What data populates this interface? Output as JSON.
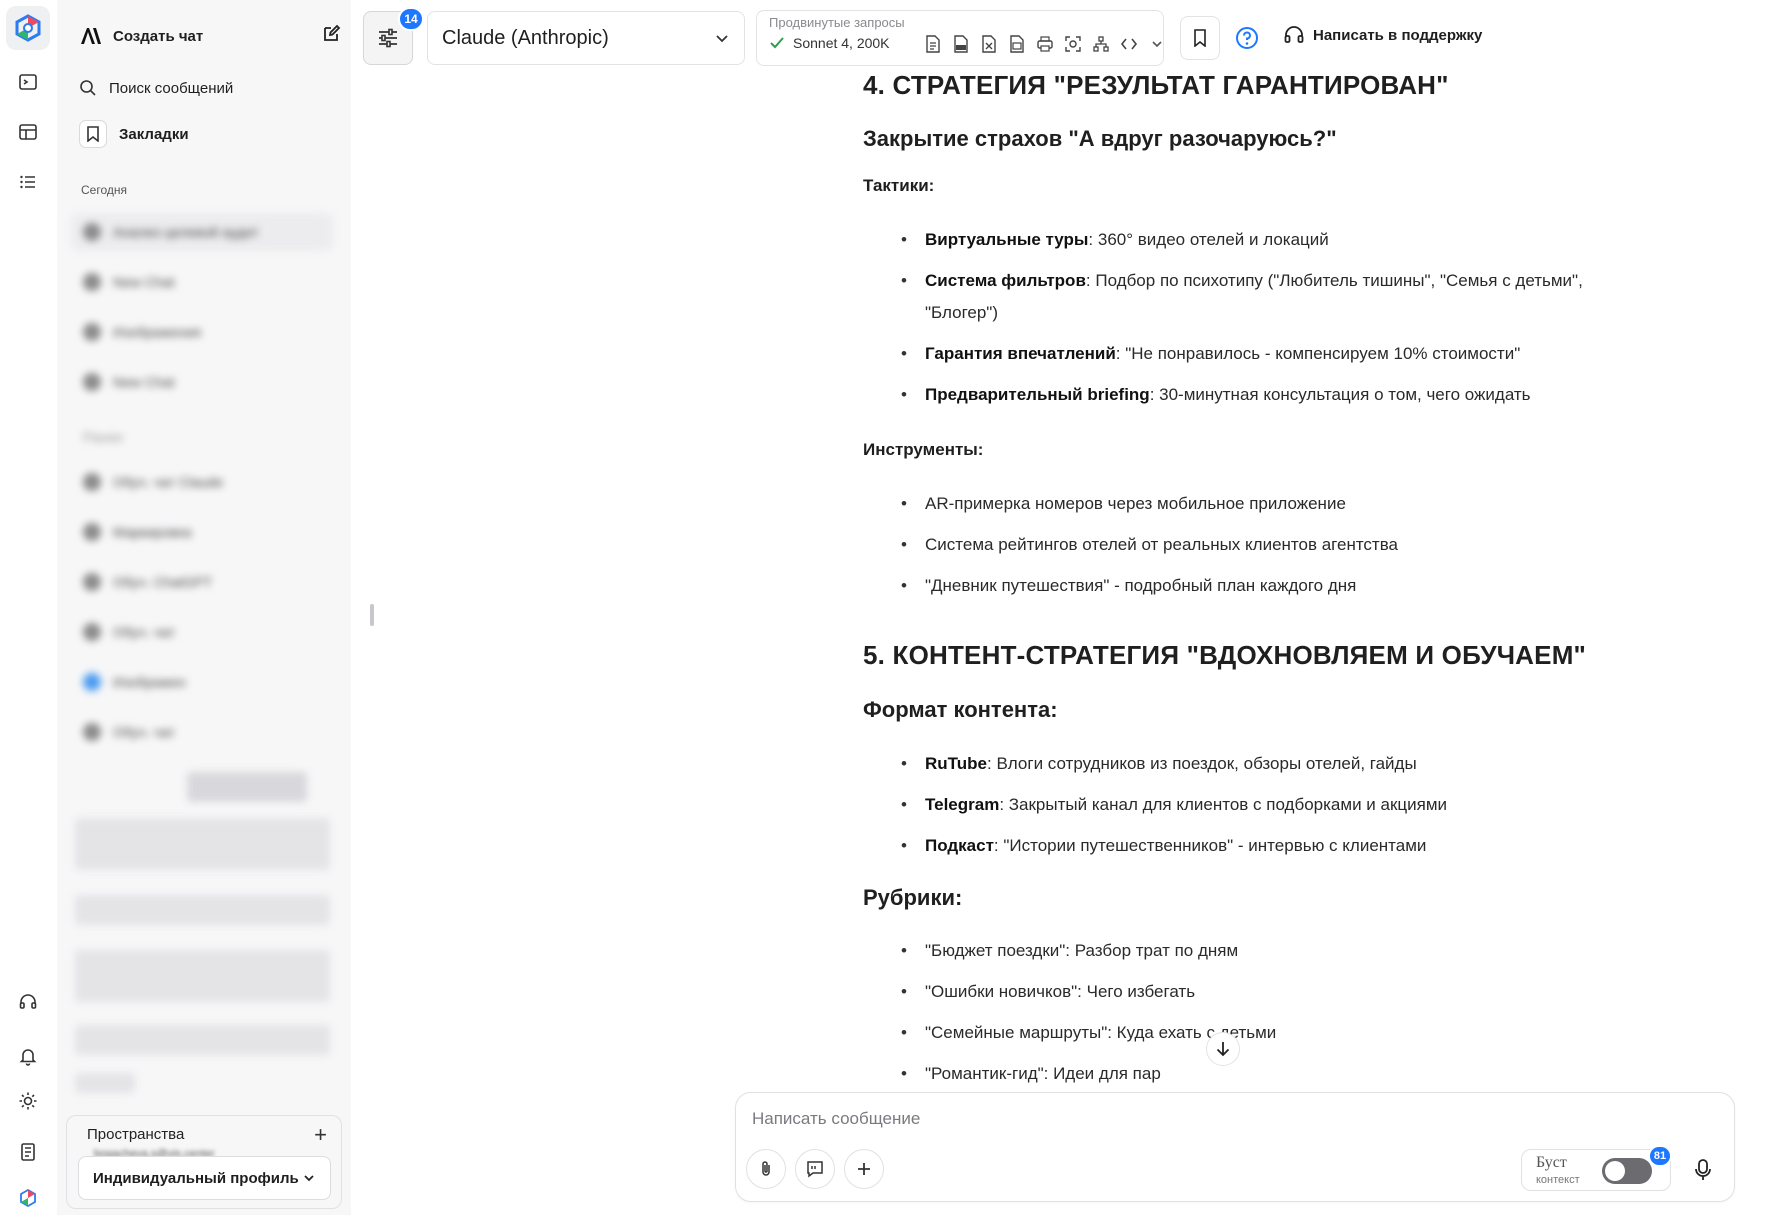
{
  "sidebar": {
    "new_chat": "Создать чат",
    "search": "Поиск сообщений",
    "bookmarks": "Закладки",
    "section_today": "Сегодня",
    "spaces_title": "Пространства",
    "profile": "Индивидуальный профиль"
  },
  "toolbar": {
    "settings_badge": "14",
    "model": "Claude (Anthropic)",
    "advanced_title": "Продвинутые запросы",
    "advanced_model": "Sonnet 4, 200K",
    "support": "Написать в поддержку"
  },
  "content": {
    "h4": "4. СТРАТЕГИЯ \"РЕЗУЛЬТАТ ГАРАНТИРОВАН\"",
    "h4_sub": "Закрытие страхов \"А вдруг разочаруюсь?\"",
    "tactics_label": "Тактики:",
    "tactics": [
      {
        "bold": "Виртуальные туры",
        "text": ": 360° видео отелей и локаций"
      },
      {
        "bold": "Система фильтров",
        "text": ": Подбор по психотипу (\"Любитель тишины\", \"Семья с детьми\", \"Блогер\")"
      },
      {
        "bold": "Гарантия впечатлений",
        "text": ": \"Не понравилось - компенсируем 10% стоимости\""
      },
      {
        "bold": "Предварительный briefing",
        "text": ": 30-минутная консультация о том, чего ожидать"
      }
    ],
    "tools_label": "Инструменты:",
    "tools": [
      "AR-примерка номеров через мобильное приложение",
      "Система рейтингов отелей от реальных клиентов агентства",
      "\"Дневник путешествия\" - подробный план каждого дня"
    ],
    "h5": "5. КОНТЕНТ-СТРАТЕГИЯ \"ВДОХНОВЛЯЕМ И ОБУЧАЕМ\"",
    "format_label": "Формат контента:",
    "formats": [
      {
        "bold": "RuTube",
        "text": ": Влоги сотрудников из поездок, обзоры отелей, гайды"
      },
      {
        "bold": "Telegram",
        "text": ": Закрытый канал для клиентов с подборками и акциями"
      },
      {
        "bold": "Подкаст",
        "text": ": \"Истории путешественников\" - интервью с клиентами"
      }
    ],
    "rubrics_label": "Рубрики:",
    "rubrics": [
      "\"Бюджет поездки\": Разбор трат по дням",
      "\"Ошибки новичков\": Чего избегать",
      "\"Семейные маршруты\": Куда ехать с детьми",
      "\"Романтик-гид\": Идеи для пар"
    ]
  },
  "composer": {
    "placeholder": "Написать сообщение",
    "boost_label": "Буст",
    "boost_sub": "контекст",
    "boost_badge": "81"
  },
  "icons": [
    "app-logo-icon",
    "terminal-icon",
    "table-icon",
    "list-icon",
    "headset-icon",
    "bell-icon",
    "sun-icon",
    "document-icon",
    "profile-logo-icon",
    "edit-icon",
    "search-icon",
    "bookmark-icon",
    "sliders-icon",
    "chevron-down-icon",
    "check-icon",
    "help-icon",
    "arrow-down-icon",
    "paperclip-icon",
    "prompt-icon",
    "plus-icon",
    "mic-icon"
  ],
  "colors": {
    "accent": "#1e78ff",
    "check": "#2e9e4f",
    "sidebar_bg": "#f7f7f8"
  }
}
